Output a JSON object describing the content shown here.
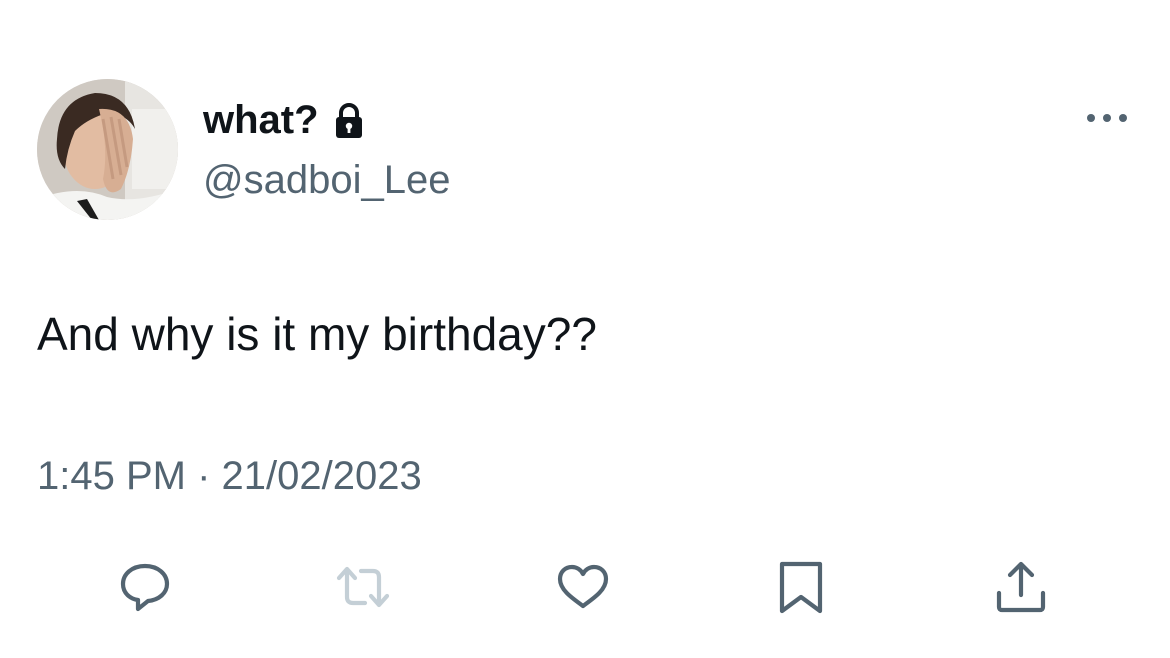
{
  "author": {
    "display_name": "what?",
    "handle": "@sadboi_Lee",
    "protected_icon": "lock-icon",
    "avatar": "profile-photo"
  },
  "menu": {
    "more_icon": "ellipsis-icon"
  },
  "tweet": {
    "text": "And why is it my birthday??",
    "timestamp": "1:45 PM · 21/02/2023"
  },
  "actions": [
    {
      "name": "reply",
      "icon": "reply-icon",
      "disabled": false
    },
    {
      "name": "retweet",
      "icon": "retweet-icon",
      "disabled": true
    },
    {
      "name": "like",
      "icon": "heart-icon",
      "disabled": false
    },
    {
      "name": "bookmark",
      "icon": "bookmark-icon",
      "disabled": false
    },
    {
      "name": "share",
      "icon": "share-icon",
      "disabled": false
    }
  ],
  "colors": {
    "text_primary": "#0f1419",
    "text_secondary": "#536471",
    "icon": "#536471",
    "icon_disabled": "#c4cfd6",
    "background": "#ffffff"
  }
}
